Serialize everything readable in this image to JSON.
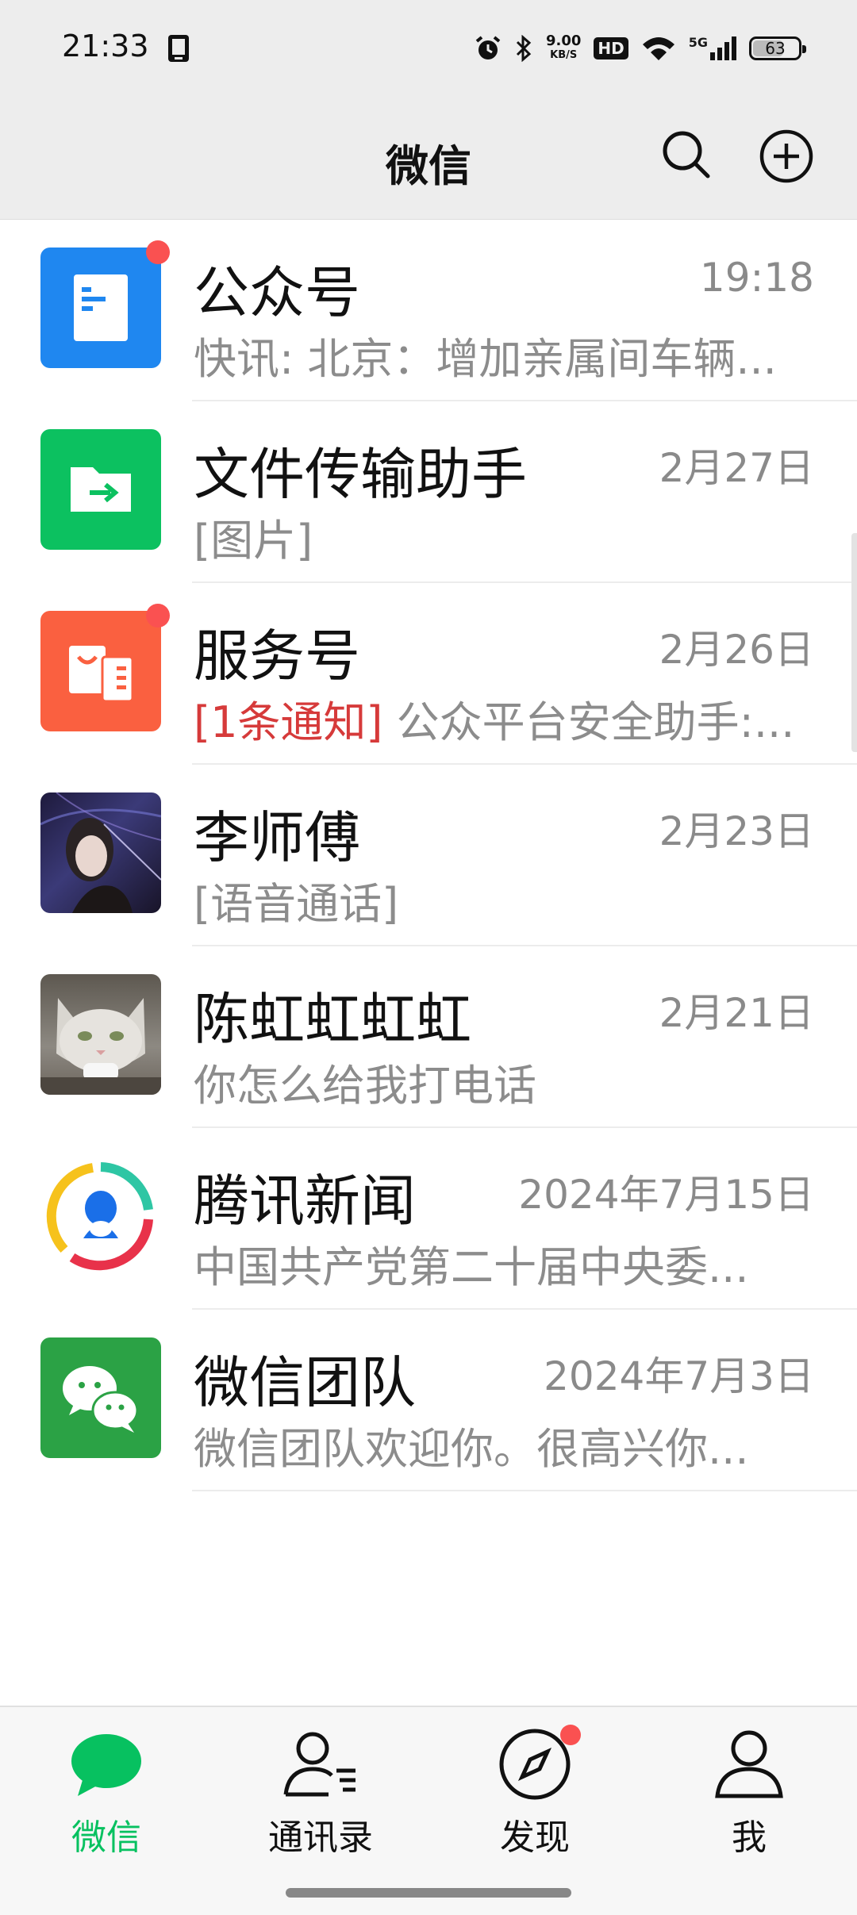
{
  "status_bar": {
    "time": "21:33",
    "net_speed_value": "9.00",
    "net_speed_unit": "KB/S",
    "hd_label": "HD",
    "signal_label": "5G",
    "battery_level": "63",
    "icons": [
      "phone-icon",
      "alarm-icon",
      "bluetooth-icon",
      "wifi-icon",
      "signal-icon",
      "battery-icon"
    ]
  },
  "header": {
    "title": "微信",
    "search_icon": "search-icon",
    "add_icon": "plus-circle-icon"
  },
  "chats": [
    {
      "name": "公众号",
      "time": "19:18",
      "preview": "快讯: 北京：增加亲属间车辆...",
      "tag": "",
      "unread_dot": true,
      "avatar_icon": "document-icon",
      "avatar_color": "#1f87f0"
    },
    {
      "name": "文件传输助手",
      "time": "2月27日",
      "preview": "[图片]",
      "tag": "",
      "unread_dot": false,
      "avatar_icon": "folder-transfer-icon",
      "avatar_color": "#0cc160"
    },
    {
      "name": "服务号",
      "time": "2月26日",
      "preview": "公众平台安全助手:...",
      "tag": "[1条通知]",
      "unread_dot": true,
      "avatar_icon": "service-bag-icon",
      "avatar_color": "#fa6040"
    },
    {
      "name": "李师傅",
      "time": "2月23日",
      "preview": "[语音通话]",
      "tag": "",
      "unread_dot": false,
      "avatar_icon": "user-photo",
      "avatar_color": "#2a2450"
    },
    {
      "name": "陈虹虹虹虹",
      "time": "2月21日",
      "preview": "你怎么给我打电话",
      "tag": "",
      "unread_dot": false,
      "avatar_icon": "cat-photo",
      "avatar_color": "#8d8982"
    },
    {
      "name": "腾讯新闻",
      "time": "2024年7月15日",
      "preview": "中国共产党第二十届中央委...",
      "tag": "",
      "unread_dot": false,
      "avatar_icon": "tencent-news-logo",
      "avatar_color": "#ffffff"
    },
    {
      "name": "微信团队",
      "time": "2024年7月3日",
      "preview": "微信团队欢迎你。很高兴你...",
      "tag": "",
      "unread_dot": false,
      "avatar_icon": "wechat-logo",
      "avatar_color": "#2ba245"
    }
  ],
  "tabs": [
    {
      "label": "微信",
      "icon": "chat-bubble-icon",
      "active": true,
      "badge": false
    },
    {
      "label": "通讯录",
      "icon": "contacts-icon",
      "active": false,
      "badge": false
    },
    {
      "label": "发现",
      "icon": "compass-icon",
      "active": false,
      "badge": true
    },
    {
      "label": "我",
      "icon": "person-icon",
      "active": false,
      "badge": false
    }
  ],
  "colors": {
    "accent": "#07c160",
    "badge": "#fa5151",
    "notice": "#d63a3a",
    "header_bg": "#ededed"
  }
}
